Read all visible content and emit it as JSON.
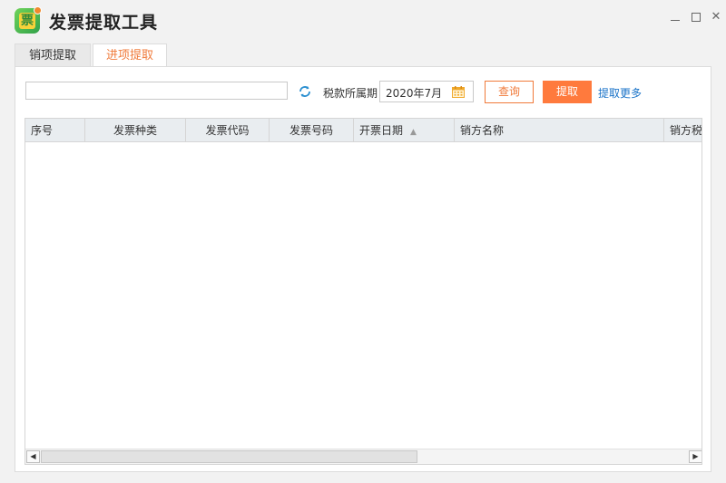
{
  "app": {
    "title": "发票提取工具",
    "logo_char": "票"
  },
  "tabs": [
    {
      "label": "销项提取",
      "active": false
    },
    {
      "label": "进项提取",
      "active": true
    }
  ],
  "toolbar": {
    "search_value": "",
    "search_placeholder": "",
    "period_label": "税款所属期",
    "period_value": "2020年7月",
    "query_label": "查询",
    "extract_label": "提取",
    "more_label": "提取更多"
  },
  "table": {
    "columns": [
      "序号",
      "发票种类",
      "发票代码",
      "发票号码",
      "开票日期",
      "销方名称",
      "销方税号"
    ],
    "sort_indicator": "▲",
    "rows": []
  },
  "colors": {
    "accent": "#ff7a3d",
    "link": "#1a73c8",
    "header_bg": "#e9edf0"
  }
}
